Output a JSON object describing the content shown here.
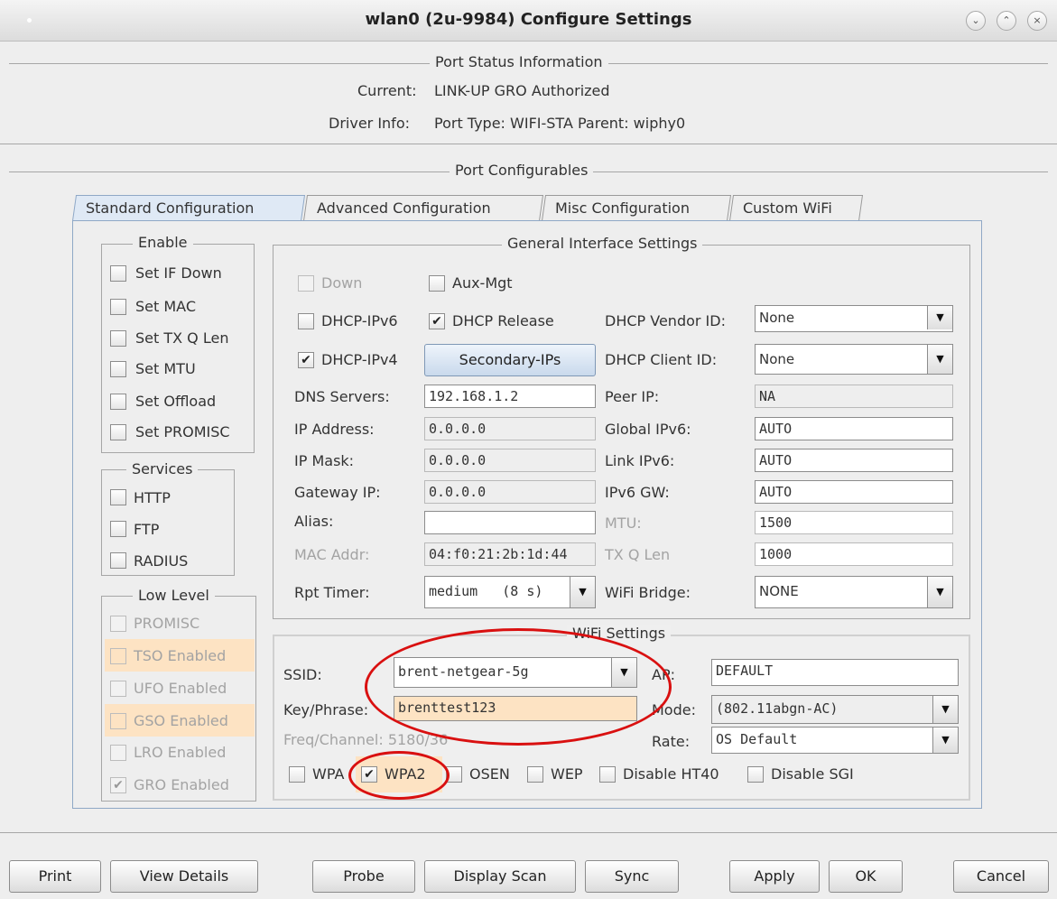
{
  "window": {
    "title": "wlan0  (2u-9984) Configure Settings",
    "controls": [
      "⌄",
      "⌃",
      "×"
    ]
  },
  "status": {
    "title": "Port Status Information",
    "current_label": "Current:",
    "current_value": "LINK-UP GRO  Authorized",
    "driver_label": "Driver Info:",
    "driver_value": "Port Type: WIFI-STA   Parent: wiphy0"
  },
  "configurables_title": "Port Configurables",
  "tabs": [
    "Standard Configuration",
    "Advanced Configuration",
    "Misc Configuration",
    "Custom WiFi"
  ],
  "enable": {
    "title": "Enable",
    "items": [
      {
        "label": "Set IF Down",
        "checked": false
      },
      {
        "label": "Set MAC",
        "checked": false
      },
      {
        "label": "Set TX Q Len",
        "checked": false
      },
      {
        "label": "Set MTU",
        "checked": false
      },
      {
        "label": "Set Offload",
        "checked": false
      },
      {
        "label": "Set PROMISC",
        "checked": false
      }
    ]
  },
  "services": {
    "title": "Services",
    "items": [
      {
        "label": "HTTP",
        "checked": false
      },
      {
        "label": "FTP",
        "checked": false
      },
      {
        "label": "RADIUS",
        "checked": false
      }
    ]
  },
  "low_level": {
    "title": "Low Level",
    "items": [
      {
        "label": "PROMISC",
        "checked": false,
        "highlight": false
      },
      {
        "label": "TSO Enabled",
        "checked": false,
        "highlight": true
      },
      {
        "label": "UFO Enabled",
        "checked": false,
        "highlight": false
      },
      {
        "label": "GSO Enabled",
        "checked": false,
        "highlight": true
      },
      {
        "label": "LRO Enabled",
        "checked": false,
        "highlight": false
      },
      {
        "label": "GRO Enabled",
        "checked": true,
        "highlight": false
      }
    ]
  },
  "general": {
    "title": "General Interface Settings",
    "down": "Down",
    "aux_mgt": "Aux-Mgt",
    "dhcp_ipv6": "DHCP-IPv6",
    "dhcp_release": "DHCP Release",
    "dhcp_ipv4": "DHCP-IPv4",
    "secondary_ips": "Secondary-IPs",
    "dhcp_vendor_label": "DHCP Vendor ID:",
    "dhcp_vendor_value": "None",
    "dhcp_client_label": "DHCP Client ID:",
    "dhcp_client_value": "None",
    "dns_label": "DNS Servers:",
    "dns_value": "192.168.1.2",
    "peer_label": "Peer IP:",
    "peer_value": "NA",
    "ip_label": "IP Address:",
    "ip_value": "0.0.0.0",
    "gipv6_label": "Global IPv6:",
    "gipv6_value": "AUTO",
    "mask_label": "IP Mask:",
    "mask_value": "0.0.0.0",
    "lipv6_label": "Link IPv6:",
    "lipv6_value": "AUTO",
    "gw_label": "Gateway IP:",
    "gw_value": "0.0.0.0",
    "ipv6gw_label": "IPv6 GW:",
    "ipv6gw_value": "AUTO",
    "alias_label": "Alias:",
    "alias_value": "",
    "mtu_label": "MTU:",
    "mtu_value": "1500",
    "mac_label": "MAC Addr:",
    "mac_value": "04:f0:21:2b:1d:44",
    "txq_label": "TX Q Len",
    "txq_value": "1000",
    "rpt_label": "Rpt Timer:",
    "rpt_value": "medium   (8 s)",
    "bridge_label": "WiFi Bridge:",
    "bridge_value": "NONE"
  },
  "wifi": {
    "title": "WiFi Settings",
    "ssid_label": "SSID:",
    "ssid_value": "brent-netgear-5g",
    "ap_label": "AP:",
    "ap_value": "DEFAULT",
    "key_label": "Key/Phrase:",
    "key_value": "brenttest123",
    "mode_label": "Mode:",
    "mode_value": "(802.11abgn-AC)",
    "freq_label": "Freq/Channel: 5180/36",
    "rate_label": "Rate:",
    "rate_value": "OS Default",
    "wpa": "WPA",
    "wpa2": "WPA2",
    "osen": "OSEN",
    "wep": "WEP",
    "disable_ht40": "Disable HT40",
    "disable_sgi": "Disable SGI"
  },
  "footer": {
    "print": "Print",
    "view_details": "View Details",
    "probe": "Probe",
    "display_scan": "Display Scan",
    "sync": "Sync",
    "apply": "Apply",
    "ok": "OK",
    "cancel": "Cancel"
  },
  "colors": {
    "highlight": "#fde3c3",
    "annotation": "#d91010",
    "active_tab": "#dfe9f5"
  }
}
